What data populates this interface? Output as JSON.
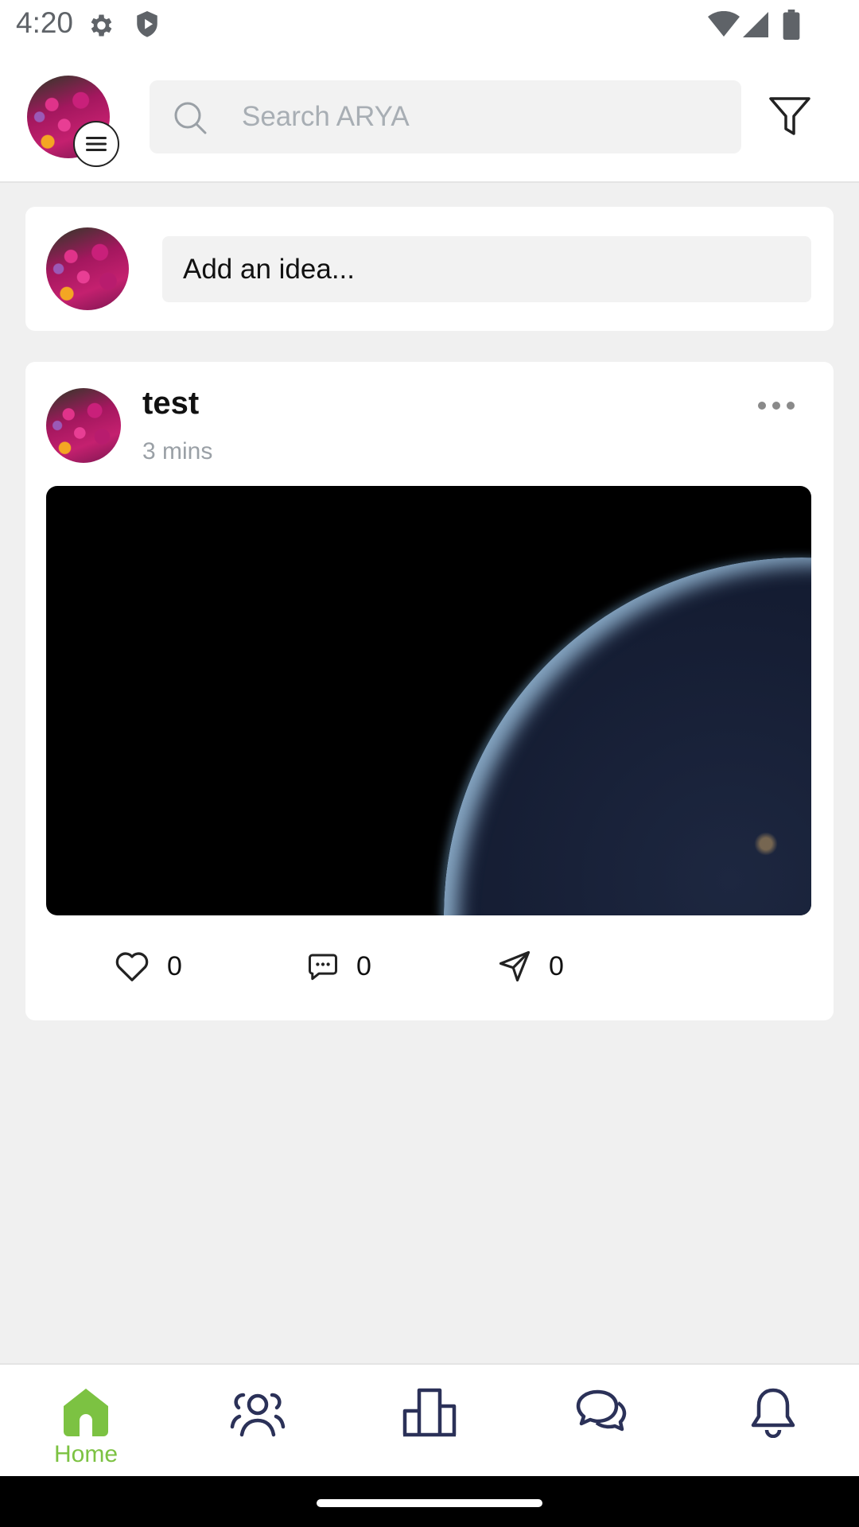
{
  "status_bar": {
    "time": "4:20",
    "left_icons": [
      "settings-icon",
      "shield-icon"
    ],
    "right_icons": [
      "wifi-icon",
      "signal-icon",
      "battery-icon"
    ]
  },
  "header": {
    "search_placeholder": "Search ARYA",
    "icons": [
      "menu-icon",
      "search-icon",
      "filter-icon"
    ]
  },
  "compose": {
    "placeholder": "Add an idea..."
  },
  "post": {
    "author": "test",
    "time": "3 mins",
    "likes": "0",
    "comments": "0",
    "shares": "0",
    "icons": [
      "more-icon",
      "heart-icon",
      "comment-icon",
      "send-icon"
    ]
  },
  "bottom_nav": {
    "items": [
      {
        "label": "Home",
        "icon": "home-icon",
        "active": true
      },
      {
        "label": "",
        "icon": "people-icon"
      },
      {
        "label": "",
        "icon": "stats-icon"
      },
      {
        "label": "",
        "icon": "chat-icon"
      },
      {
        "label": "",
        "icon": "bell-icon"
      }
    ],
    "active_color": "#7cc242",
    "icon_color": "#2b3158"
  }
}
